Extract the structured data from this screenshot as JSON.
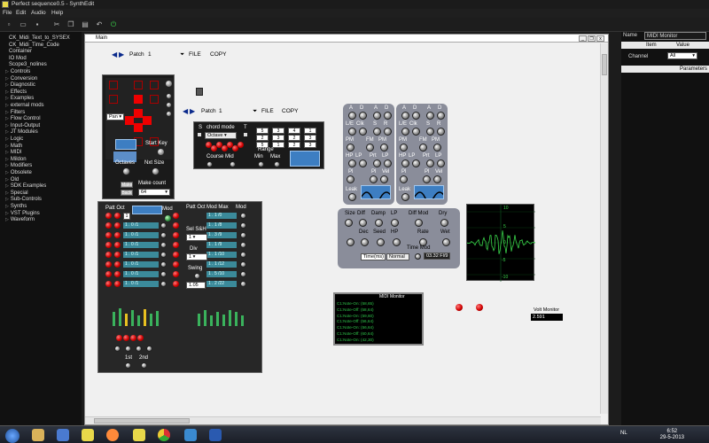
{
  "app": {
    "title": "Perfect sequence0.5 - SynthEdit",
    "menu": [
      "File",
      "Edit",
      "Audio",
      "Help"
    ]
  },
  "toolbar": {
    "icons": [
      "new-icon",
      "open-icon",
      "save-icon",
      "cut-icon",
      "copy-icon",
      "paste-icon",
      "undo-icon",
      "power-icon"
    ]
  },
  "sidebar": {
    "items": [
      {
        "label": "CK_Midi_Text_to_SYSEX",
        "expandable": false
      },
      {
        "label": "CK_Midi_Time_Code",
        "expandable": false
      },
      {
        "label": "Container",
        "expandable": false
      },
      {
        "label": "IO Mod",
        "expandable": false
      },
      {
        "label": "Scope3_nolines",
        "expandable": false
      },
      {
        "label": "Controls",
        "expandable": true
      },
      {
        "label": "Conversion",
        "expandable": true
      },
      {
        "label": "Diagnostic",
        "expandable": true
      },
      {
        "label": "Effects",
        "expandable": true
      },
      {
        "label": "Examples",
        "expandable": true
      },
      {
        "label": "external mods",
        "expandable": true
      },
      {
        "label": "Filters",
        "expandable": true
      },
      {
        "label": "Flow Control",
        "expandable": true
      },
      {
        "label": "Input-Output",
        "expandable": true
      },
      {
        "label": "JT Modules",
        "expandable": true
      },
      {
        "label": "Logic",
        "expandable": true
      },
      {
        "label": "Math",
        "expandable": true
      },
      {
        "label": "MIDI",
        "expandable": true
      },
      {
        "label": "Mildon",
        "expandable": true
      },
      {
        "label": "Modifiers",
        "expandable": true
      },
      {
        "label": "Obsolete",
        "expandable": true
      },
      {
        "label": "Old",
        "expandable": true
      },
      {
        "label": "SDK Examples",
        "expandable": true
      },
      {
        "label": "Special",
        "expandable": true
      },
      {
        "label": "Sub-Controls",
        "expandable": true
      },
      {
        "label": "Synths",
        "expandable": true
      },
      {
        "label": "VST Plugins",
        "expandable": true
      },
      {
        "label": "Waveform",
        "expandable": true
      }
    ]
  },
  "main_window": {
    "title": "Main",
    "patch_bar_1": {
      "patch_label": "Patch",
      "patch_value": "1",
      "file": "FILE",
      "copy": "COPY"
    },
    "patch_bar_2": {
      "patch_label": "Patch",
      "patch_value": "1",
      "file": "FILE",
      "copy": "COPY"
    }
  },
  "seq_panel": {
    "pan_select": "Pan",
    "start_key": "Start Key",
    "octaves": "Octaves",
    "nxt_size": "Nxt Size",
    "make": "Make",
    "back": "Back",
    "make_count": "Make count",
    "make_count_value": "64"
  },
  "chord_panel": {
    "s_label": "S",
    "chord_mode": "chord mode",
    "t_label": "T",
    "mode_value": "Octave",
    "course_mid": "Course Mid",
    "range": "Range",
    "min": "Min",
    "max": "Max",
    "grid_values": [
      "5",
      "3",
      "4",
      "1",
      "2",
      "3",
      "2",
      "3",
      "5",
      "1",
      "2",
      "3"
    ]
  },
  "patt_panel": {
    "patt_oct": "Patt Oct",
    "mod": "Mod",
    "mod_max": "Mod Max",
    "patt_oct_2": "Patt Oct",
    "mod_2": "Mod",
    "sel_sh": "Sel S&H",
    "sel_sh_value": "1",
    "div": "Div",
    "div_value": "1",
    "swing": "Swing",
    "swing_value": "1.05",
    "first_row_value": "1",
    "left_cells": [
      "1 . 0 /1",
      "1 . 0 /1",
      "1 . 0 /1",
      "1 . 0 /1",
      "1 . 0 /1",
      "1 . 0 /1",
      "1 . 0 /1"
    ],
    "right_cells": [
      "1 . 1 /0",
      "1 . 1 /8",
      "1 . 3 /9",
      "1 . 1 /9",
      "1 . 1 /10",
      "1 . 1 /12",
      "1 . 5 /10",
      "1 . 2 /22"
    ],
    "bottom_1": "1st",
    "bottom_2": "2nd"
  },
  "lfo_panel_1": {
    "row1": [
      "A",
      "D",
      "A",
      "D"
    ],
    "row2": [
      "L/E",
      "Clk",
      "S",
      "R"
    ],
    "row3": [
      "PM",
      "FM",
      "PM"
    ],
    "row4": [
      "HP",
      "LP",
      "Prt",
      "LP"
    ],
    "row5": [
      "Pl",
      "Pl",
      "Vel"
    ],
    "leak": "Leak"
  },
  "lfo_panel_2": {
    "row1": [
      "A",
      "D",
      "A",
      "D"
    ],
    "row2": [
      "L/E",
      "Clk",
      "S",
      "R"
    ],
    "row3": [
      "PM",
      "FM",
      "PM"
    ],
    "row4": [
      "HP",
      "LP",
      "Prt",
      "LP"
    ],
    "row5": [
      "Pl",
      "Pl",
      "Vel"
    ],
    "leak": "Leak"
  },
  "reverb_panel": {
    "labels": [
      "Size",
      "Diff",
      "Damp",
      "LP",
      "Diff Mod",
      "Dry"
    ],
    "dec": "Dec",
    "seed": "Seed",
    "hp": "HP",
    "rate": "Rate",
    "wet": "Wet",
    "time_mod": "Time Mod",
    "time_select": "Time(ms)",
    "normal": "Normal",
    "readout": "03.32 Fl/9"
  },
  "scope": {
    "y_top": "10",
    "y_mid1": "5",
    "y_zero": "0",
    "y_mid2": "-5",
    "y_bottom": "-10"
  },
  "midi_console": {
    "title": "MIDI Monitor",
    "lines": [
      "C1:Note-On: (58,65)",
      "C1:Note-Off: (58,64)",
      "C1:Note-On: (59,60)",
      "C1:Note-Off: (56,64)",
      "C1:Note-On: (56,64)",
      "C1:Note-Off: (60,64)",
      "C1:Note-On: (42,30)"
    ]
  },
  "volt_monitor": {
    "label": "Volt Monitor",
    "value": "2.591"
  },
  "right_panel": {
    "col_name": "Name",
    "col_name_value": "MIDI Monitor",
    "col_item": "Item",
    "col_value": "Value",
    "channel_label": "Channel",
    "channel_value": "All",
    "parameters": "Parameters"
  },
  "taskbar": {
    "time": "6:52",
    "date": "29-5-2013",
    "lang": "NL"
  },
  "colors": {
    "accent_red": "#d00000",
    "accent_blue": "#3d7ec2",
    "scope_green": "#3ad44a",
    "panel_grey": "#8a8d9a"
  }
}
